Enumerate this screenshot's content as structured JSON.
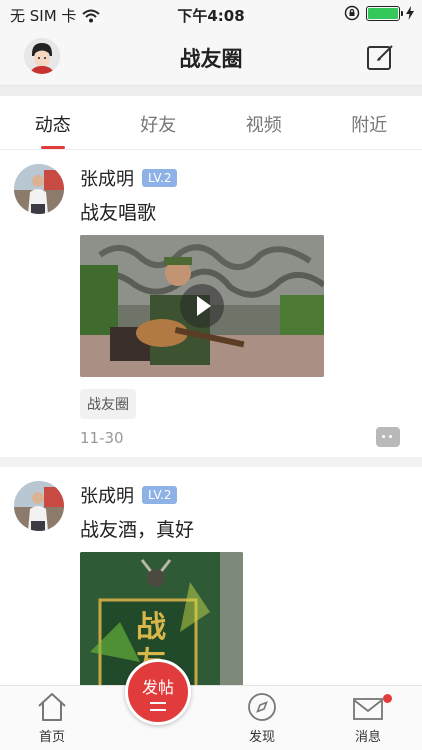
{
  "status_bar": {
    "carrier": "无 SIM 卡",
    "time": "下午4:08",
    "battery_level": 1.0
  },
  "nav": {
    "title": "战友圈",
    "left_icon": "user-avatar-icon",
    "right_icon": "compose-icon"
  },
  "tabs": [
    {
      "label": "动态",
      "active": true
    },
    {
      "label": "好友",
      "active": false
    },
    {
      "label": "视频",
      "active": false
    },
    {
      "label": "附近",
      "active": false
    }
  ],
  "posts": [
    {
      "author": "张成明",
      "level": "LV.2",
      "text": "战友唱歌",
      "media": "video",
      "tag": "战友圈",
      "date": "11-30"
    },
    {
      "author": "张成明",
      "level": "LV.2",
      "text": "战友酒，真好",
      "media": "image",
      "image_text": "战友"
    }
  ],
  "tabbar": {
    "home": "首页",
    "post": "发帖",
    "discover": "发现",
    "messages": "消息"
  },
  "colors": {
    "accent": "#e23b3b",
    "level_badge": "#8fb2e6"
  }
}
